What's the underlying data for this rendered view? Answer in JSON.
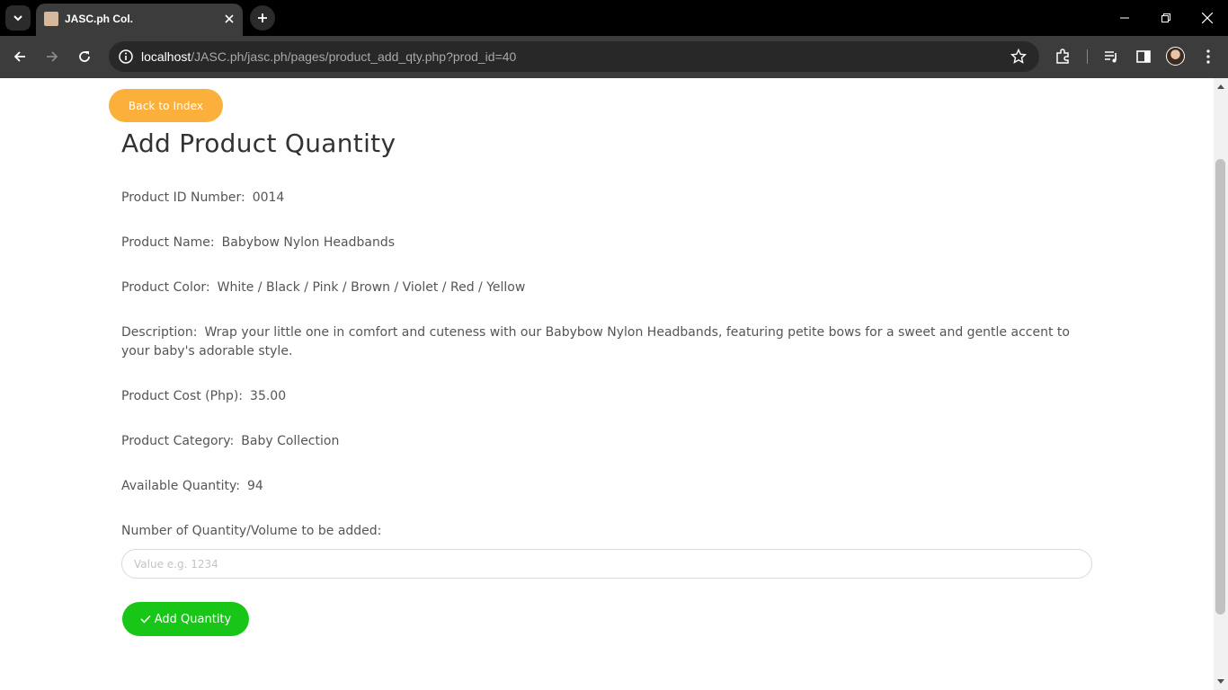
{
  "browser": {
    "tab_title": "JASC.ph Col.",
    "url_host": "localhost",
    "url_path": "/JASC.ph/jasc.ph/pages/product_add_qty.php?prod_id=40",
    "icons": [
      "tab-search-icon",
      "close-icon",
      "plus-icon",
      "minimize-icon",
      "restore-icon",
      "back-icon",
      "forward-icon",
      "reload-icon",
      "info-icon",
      "star-icon",
      "extensions-icon",
      "media-icon",
      "sidepanel-icon",
      "menu-icon"
    ]
  },
  "page": {
    "back_button": "Back to Index",
    "title": "Add Product Quantity",
    "fields": [
      {
        "label": "Product ID Number:",
        "value": "0014"
      },
      {
        "label": "Product Name:",
        "value": "Babybow Nylon Headbands"
      },
      {
        "label": "Product Color:",
        "value": "White / Black / Pink / Brown / Violet / Red / Yellow"
      },
      {
        "label": "Description:",
        "value": "Wrap your little one in comfort and cuteness with our Babybow Nylon Headbands, featuring petite bows for a sweet and gentle accent to your baby's adorable style."
      },
      {
        "label": "Product Cost (Php):",
        "value": "35.00"
      },
      {
        "label": "Product Category:",
        "value": "Baby Collection"
      },
      {
        "label": "Available Quantity:",
        "value": "94"
      }
    ],
    "qty_label": "Number of Quantity/Volume to be added:",
    "qty_placeholder": "Value e.g. 1234",
    "qty_value": "",
    "add_button": "Add Quantity",
    "colors": {
      "back_button": "#fbb03b",
      "add_button": "#17c617"
    }
  }
}
